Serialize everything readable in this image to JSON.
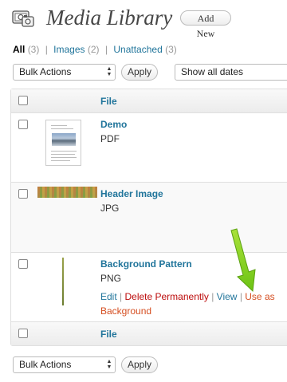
{
  "header": {
    "title": "Media Library",
    "add_new_label": "Add New",
    "icon": "media-library-icon"
  },
  "filters": [
    {
      "label": "All",
      "count": "(3)",
      "current": true
    },
    {
      "label": "Images",
      "count": "(2)",
      "current": false
    },
    {
      "label": "Unattached",
      "count": "(3)",
      "current": false
    }
  ],
  "top_controls": {
    "bulk_actions": "Bulk Actions",
    "apply": "Apply",
    "dates": "Show all dates"
  },
  "bottom_controls": {
    "bulk_actions": "Bulk Actions",
    "apply": "Apply"
  },
  "table": {
    "column_file": "File",
    "rows": [
      {
        "title": "Demo",
        "type": "PDF"
      },
      {
        "title": "Header Image",
        "type": "JPG"
      },
      {
        "title": "Background Pattern",
        "type": "PNG",
        "actions": {
          "edit": "Edit",
          "delete": "Delete Permanently",
          "view": "View",
          "use_as_1": "Use as",
          "use_as_2": "Background"
        }
      }
    ]
  },
  "colors": {
    "link": "#21759b",
    "delete": "#bc0b0b",
    "use_as": "#d54e21",
    "arrow": "#8ed51e"
  }
}
